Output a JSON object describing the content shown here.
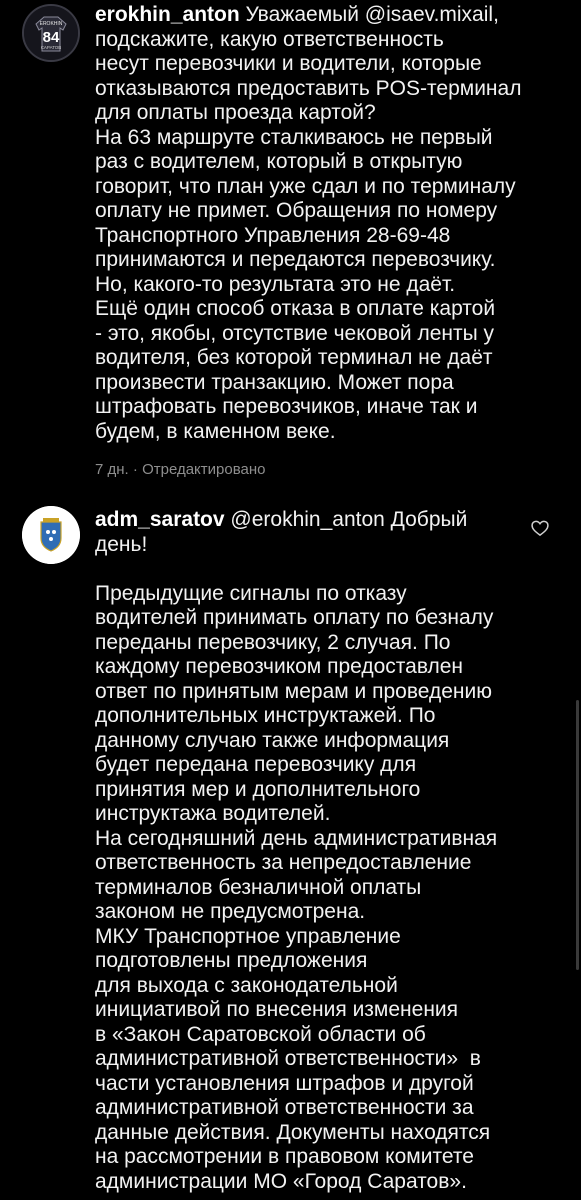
{
  "comments": [
    {
      "username": "erokhin_anton",
      "avatar_icon": "hockey-jersey-avatar",
      "avatar_text_top": "EROKHIN",
      "avatar_number": "84",
      "avatar_text_bottom": "САРАТОВ",
      "text": " Уважаемый @isaev.mixail,\nподскажите, какую ответственность\nнесут перевозчики и водители, которые\nотказываются предоставить POS-терминал\nдля оплаты проезда картой?\nНа 63 маршруте сталкиваюсь не первый\nраз с водителем, который в открытую\nговорит, что план уже сдал и по терминалу\nоплату не примет. Обращения по номеру\nТранспортного Управления 28-69-48\nпринимаются и передаются перевозчику.\nНо, какого-то результата это не даёт.\nЕщё один способ отказа в оплате картой\n- это, якобы, отсутствие чековой ленты у\nводителя, без которой терминал не даёт\nпроизвести транзакцию. Может пора\nштрафовать перевозчиков, иначе так и\nбудем, в каменном веке.",
      "time": "7 дн.",
      "separator": " · ",
      "edited": "Отредактировано"
    },
    {
      "username": "adm_saratov",
      "avatar_icon": "saratov-coat-of-arms-icon",
      "text": " @erokhin_anton Добрый\nдень!\n\nПредыдущие сигналы по отказу\nводителей принимать оплату по безналу\nпереданы перевозчику, 2 случая. По\nкаждому перевозчиком предоставлен\nответ по принятым мерам и проведению\nдополнительных инструктажей. По\nданному случаю также информация\nбудет передана перевозчику для\nпринятия мер и дополнительного\nинструктажа водителей.\nНа сегодняшний день административная\nответственность за непредоставление\nтерминалов безналичной оплаты\nзаконом не предусмотрена.\nМКУ Транспортное управление\nподготовлены предложения\nдля выхода с законодательной\nинициативой по внесения изменения\nв «Закон Саратовской области об\nадминистративной ответственности»  в\nчасти установления штрафов и другой\nадминистративной ответственности за\nданные действия. Документы находятся\nна рассмотрении в правовом комитете\nадминистрации МО «Город Саратов».",
      "like_icon": "heart-outline-icon"
    }
  ],
  "colors": {
    "background": "#000000",
    "text": "#f2f2f2",
    "meta": "#8e8e8e",
    "coat_of_arms_blue": "#2f6db5"
  }
}
